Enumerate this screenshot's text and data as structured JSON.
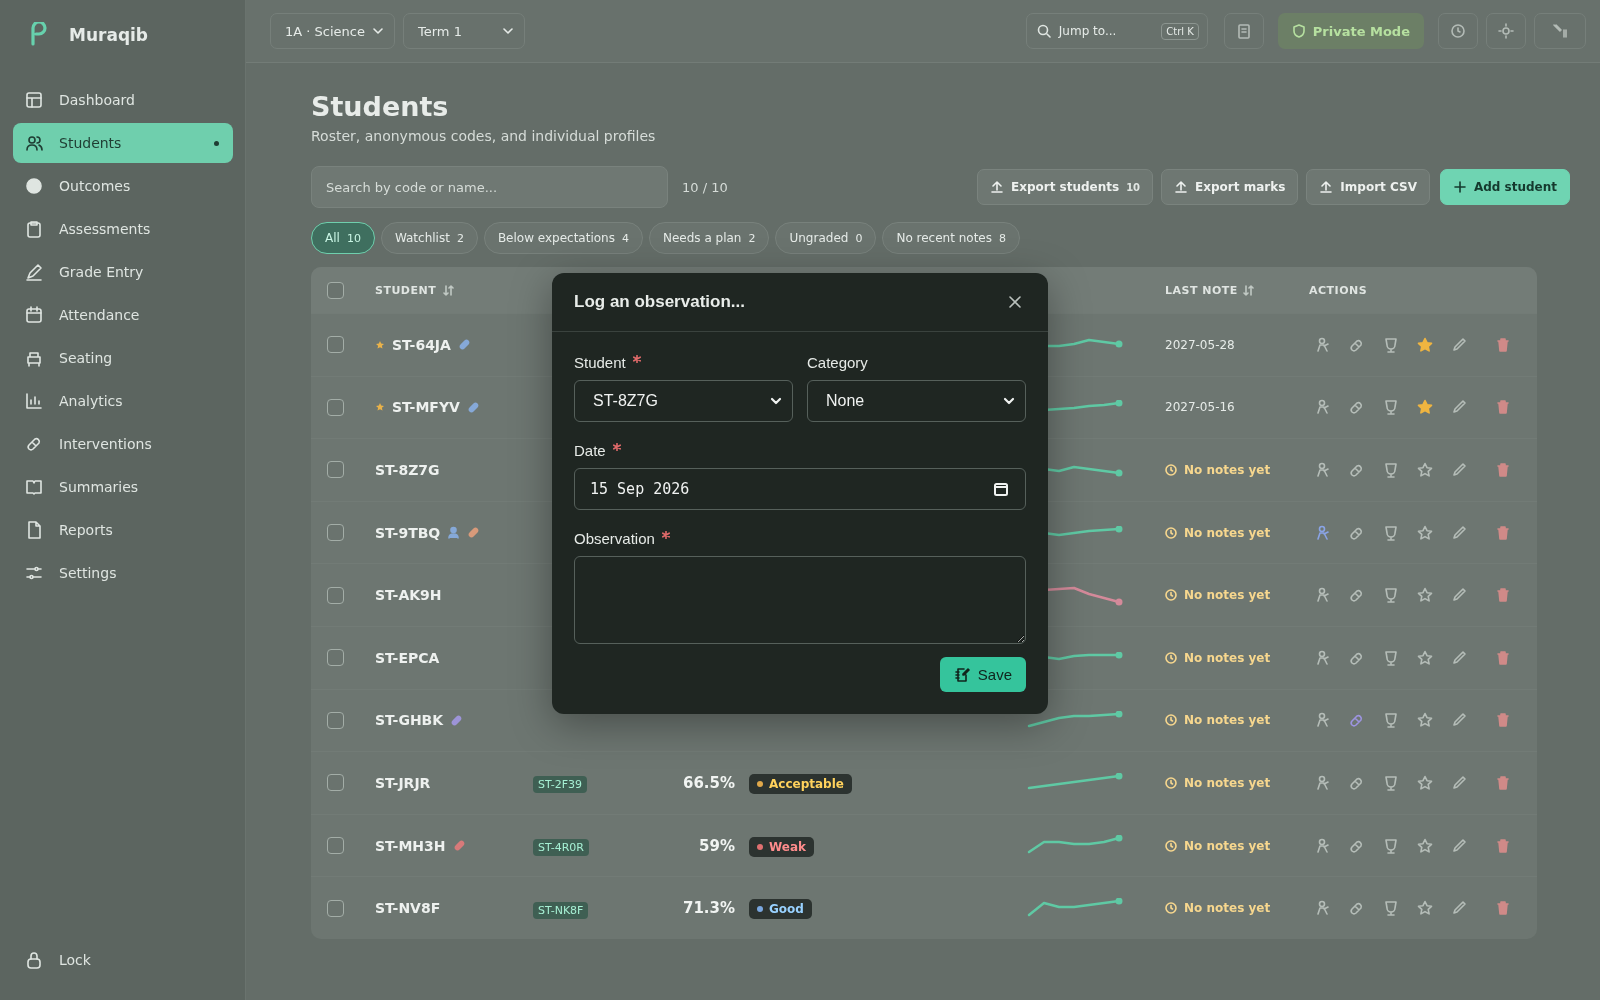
{
  "sidebar": {
    "brand": "Muraqib",
    "items": [
      {
        "label": "Dashboard",
        "selected": false
      },
      {
        "label": "Students",
        "selected": true
      },
      {
        "label": "Outcomes",
        "selected": false
      },
      {
        "label": "Assessments",
        "selected": false
      },
      {
        "label": "Grade Entry",
        "selected": false
      },
      {
        "label": "Attendance",
        "selected": false
      },
      {
        "label": "Seating",
        "selected": false
      },
      {
        "label": "Analytics",
        "selected": false
      },
      {
        "label": "Interventions",
        "selected": false
      },
      {
        "label": "Summaries",
        "selected": false
      },
      {
        "label": "Reports",
        "selected": false
      },
      {
        "label": "Settings",
        "selected": false
      }
    ],
    "footer": "Lock"
  },
  "topbar": {
    "class_select": "1A · Science",
    "term_select": "Term 1",
    "jump": {
      "placeholder": "Jump to...",
      "shortcut": "Ctrl K"
    },
    "private_mode": "Private Mode"
  },
  "page": {
    "title": "Students",
    "subtitle": "Roster, anonymous codes, and individual profiles",
    "search": {
      "placeholder": "Search by code or name..."
    },
    "count": "10 / 10",
    "buttons": [
      {
        "label": "Export students",
        "badge": "10",
        "kind": "secondary"
      },
      {
        "label": "Export marks",
        "kind": "secondary"
      },
      {
        "label": "Import CSV",
        "kind": "secondary"
      },
      {
        "label": "Add student",
        "kind": "primary"
      }
    ],
    "filters": [
      {
        "label": "All",
        "count": "10",
        "selected": true
      },
      {
        "label": "Watchlist",
        "count": "2",
        "selected": false
      },
      {
        "label": "Below expectations",
        "count": "4",
        "selected": false
      },
      {
        "label": "Needs a plan",
        "count": "2",
        "selected": false
      },
      {
        "label": "Ungraded",
        "count": "0",
        "selected": false
      },
      {
        "label": "No recent notes",
        "count": "8",
        "selected": false
      }
    ]
  },
  "table": {
    "columns": [
      "STUDENT",
      "LAST NOTE",
      "ACTIONS"
    ],
    "all_checked": false,
    "rows": [
      {
        "checked": false,
        "student": "ST-64JA",
        "starred": true,
        "tags": [
          {
            "kind": "pill",
            "color": "#86a9d8"
          }
        ],
        "trend": {
          "color": "#5fc9a4"
        },
        "last_note": {
          "kind": "date",
          "text": "2027-05-28"
        },
        "watch": false,
        "intervention": false
      },
      {
        "checked": false,
        "student": "ST-MFYV",
        "starred": true,
        "tags": [
          {
            "kind": "pill",
            "color": "#86a9d8"
          }
        ],
        "trend": {
          "color": "#5fc9a4"
        },
        "last_note": {
          "kind": "date",
          "text": "2027-05-16"
        },
        "watch": false,
        "intervention": false
      },
      {
        "checked": false,
        "student": "ST-8Z7G",
        "starred": false,
        "tags": [],
        "trend": {
          "color": "#5fc9a4"
        },
        "last_note": {
          "kind": "none",
          "text": "No notes yet"
        },
        "watch": false,
        "intervention": false
      },
      {
        "checked": false,
        "student": "ST-9TBQ",
        "starred": false,
        "tags": [
          {
            "kind": "person",
            "color": "#86a9d8"
          },
          {
            "kind": "pill",
            "color": "#d89a7a"
          }
        ],
        "trend": {
          "color": "#5fc9a4"
        },
        "last_note": {
          "kind": "none",
          "text": "No notes yet"
        },
        "watch": true,
        "intervention": false
      },
      {
        "checked": false,
        "student": "ST-AK9H",
        "starred": false,
        "tags": [],
        "trend": {
          "color": "#d48a9a"
        },
        "last_note": {
          "kind": "none",
          "text": "No notes yet"
        },
        "watch": false,
        "intervention": false
      },
      {
        "checked": false,
        "student": "ST-EPCA",
        "starred": false,
        "tags": [],
        "trend": {
          "color": "#5fc9a4"
        },
        "last_note": {
          "kind": "none",
          "text": "No notes yet"
        },
        "watch": false,
        "intervention": false
      },
      {
        "checked": false,
        "student": "ST-GHBK",
        "starred": false,
        "tags": [
          {
            "kind": "pill",
            "color": "#9d94d8"
          }
        ],
        "trend": {
          "color": "#5fc9a4"
        },
        "last_note": {
          "kind": "none",
          "text": "No notes yet"
        },
        "watch": false,
        "intervention": true
      },
      {
        "checked": false,
        "student": "ST-JRJR",
        "code": "ST-2F39",
        "percent": "66.5%",
        "band": {
          "text": "Acceptable",
          "color": "#e0a84a"
        },
        "starred": false,
        "tags": [],
        "trend": {
          "color": "#5fc9a4"
        },
        "last_note": {
          "kind": "none",
          "text": "No notes yet"
        },
        "watch": false,
        "intervention": false
      },
      {
        "checked": false,
        "student": "ST-MH3H",
        "code": "ST-4R0R",
        "percent": "59%",
        "band": {
          "text": "Weak",
          "color": "#e07070"
        },
        "starred": false,
        "tags": [
          {
            "kind": "pill",
            "color": "#d87a7a"
          }
        ],
        "trend": {
          "color": "#5fc9a4"
        },
        "last_note": {
          "kind": "none",
          "text": "No notes yet"
        },
        "watch": false,
        "intervention": false
      },
      {
        "checked": false,
        "student": "ST-NV8F",
        "code": "ST-NK8F",
        "percent": "71.3%",
        "band": {
          "text": "Good",
          "color": "#7aa8e0"
        },
        "starred": false,
        "tags": [],
        "trend": {
          "color": "#5fc9a4"
        },
        "last_note": {
          "kind": "none",
          "text": "No notes yet"
        },
        "watch": false,
        "intervention": false
      }
    ]
  },
  "dialog": {
    "title": "Log an observation...",
    "fields": [
      {
        "label": "Student",
        "required": true,
        "kind": "select",
        "value": "ST-8Z7G"
      },
      {
        "label": "Category",
        "required": false,
        "kind": "select",
        "value": "None"
      },
      {
        "label": "Date",
        "required": true,
        "kind": "date",
        "value": "15 Sep 2026"
      },
      {
        "label": "Observation",
        "required": true,
        "kind": "textarea"
      }
    ],
    "save": "Save"
  }
}
